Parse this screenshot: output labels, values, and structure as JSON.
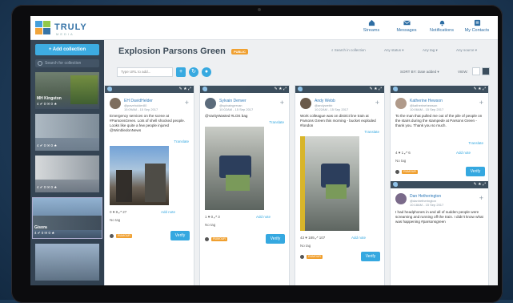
{
  "app": {
    "logo_text": "TRULY",
    "logo_sub": "MEDIA",
    "brand_color": "#2d6da3",
    "accent": "#35a8e0"
  },
  "nav": [
    {
      "label": "Streams",
      "icon": "home-icon"
    },
    {
      "label": "Messages",
      "icon": "envelope-icon"
    },
    {
      "label": "Notifications",
      "icon": "bell-icon"
    },
    {
      "label": "My Contacts",
      "icon": "contacts-icon"
    }
  ],
  "sidebar": {
    "add_label": "+ Add collection",
    "search_placeholder": "Search for collection",
    "thumbs": [
      {
        "caption": "MH Kingston",
        "meta": "4 ✔ 0 ✉ 0 ★"
      },
      {
        "caption": "",
        "meta": "4 ✔ 0 ✉ 0 ★"
      },
      {
        "caption": "",
        "meta": "4 ✔ 0 ✉ 0 ★"
      },
      {
        "caption": "Gisora",
        "meta": "4 ✔ 0 ✉ 0 ★"
      },
      {
        "caption": "",
        "meta": ""
      }
    ]
  },
  "main": {
    "title": "Explosion Parsons Green",
    "title_badge": "PUBLIC",
    "search_placeholder": "Search in collection",
    "filters": [
      "Any status ▾",
      "Any tag ▾",
      "Any source ▾"
    ],
    "type_placeholder": "Type URL to add...",
    "sort_label": "SORT BY: Date added ▾",
    "view_label": "VIEW:"
  },
  "columns": [
    {
      "name": "EH DavidHelder",
      "handle": "@paveholder80",
      "date": "15:09AM - 15 Sep 2017",
      "text": "Emergency services on the scene at #ParsonsGreen. Lots of shell shocked people. Looks like quite a few people injured @WimbledonNews",
      "translate": "Translate",
      "stats": "0 ♥ 8 ⤢ 27",
      "note": "Add note",
      "tag": "No tag",
      "pill": "RUMOUR",
      "verify": "Verify"
    },
    {
      "name": "Sylvain Denver",
      "handle": "@sylvaingervan",
      "date": "10:02AM - 15 Sep 2017",
      "text": "@VarityWasted #LOS bag",
      "translate": "Translate",
      "stats": "1 ♥ 0 ⤢ 3",
      "note": "Add note",
      "tag": "No tag",
      "pill": "RUMOUR",
      "verify": "Verify"
    },
    {
      "name": "Andy Webb",
      "handle": "@andywebb",
      "date": "10:22AM - 15 Sep 2017",
      "text": "Work colleague was on district line train at Parsons Green this morning - bucket exploded #london",
      "translate": "Translate",
      "stats": "43 ♥ 189 ⤢ 107",
      "note": "Add note",
      "tag": "No tag",
      "pill": "RUMOUR",
      "verify": "Verify"
    },
    {
      "name": "Katherine Hewson",
      "handle": "@katherinehewson",
      "date": "10:06AM - 15 Sep 2017",
      "text": "To the man that pulled me out of the pile of people on the stairs during the stampede at Parsons Green - thank you. Thank you so much.",
      "translate": "Translate",
      "stats": "4 ♥ 1 ⤢ 6",
      "note": "Add note",
      "tag": "No tag",
      "pill": "RUMOUR",
      "verify": "Verify",
      "second": {
        "name": "Dan Hetherington",
        "handle": "@danhetherington",
        "date": "10:18AM - 15 Sep 2017",
        "text": "I had headphones in and all of sudden people were screaming and running off the train. I didn't know what was happening #parsonsgreen"
      }
    }
  ]
}
